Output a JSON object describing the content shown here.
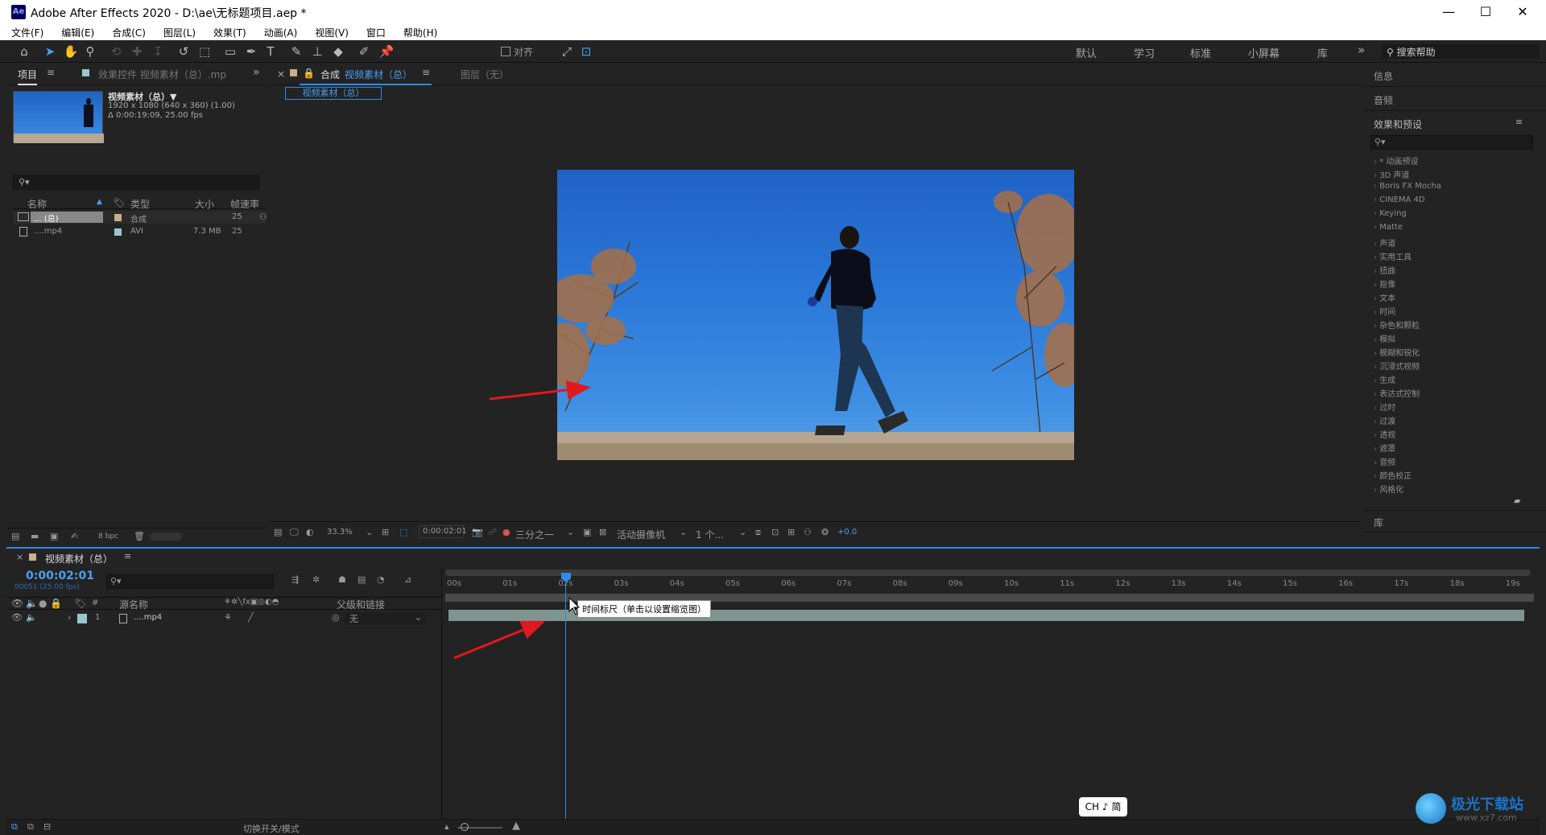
{
  "titlebar": {
    "app_icon": "Ae",
    "title": "Adobe After Effects 2020 - D:\\ae\\无标题项目.aep *",
    "minimize": "—",
    "maximize": "☐",
    "close": "✕"
  },
  "menu": [
    "文件(F)",
    "编辑(E)",
    "合成(C)",
    "图层(L)",
    "效果(T)",
    "动画(A)",
    "视图(V)",
    "窗口",
    "帮助(H)"
  ],
  "toolbar": {
    "align_label": "对齐",
    "workspaces": [
      "默认",
      "学习",
      "标准",
      "小屏幕",
      "库"
    ],
    "more": "»",
    "search_placeholder": "搜索帮助"
  },
  "project_panel": {
    "tab_project": "项目",
    "tab_effects": "效果控件 视频素材（总）.mp",
    "more": "»",
    "asset": {
      "name": "视频素材（总）▼",
      "res": "1920 x 1080  (640 x 360) (1.00)",
      "duration": "Δ 0:00:19:09, 25.00 fps"
    },
    "columns": [
      "名称",
      "类型",
      "大小",
      "帧速率"
    ],
    "rows": [
      {
        "name": "... (总)",
        "type": "合成",
        "size": "",
        "fps": "25",
        "color": "#c8b08a"
      },
      {
        "name": "....mp4",
        "type": "AVI",
        "size": "7.3 MB",
        "fps": "25",
        "color": "#9ac6d0"
      }
    ],
    "bpc": "8 bpc"
  },
  "viewer": {
    "tab_comp_prefix": "合成",
    "tab_comp_name": "视频素材（总）",
    "tab_layer": "图层（无）",
    "crumb": "视频素材（总）",
    "zoom": "33.3%",
    "timecode": "0:00:02:01",
    "resolution": "三分之一",
    "camera": "活动摄像机",
    "views": "1 个...",
    "exposure": "+0.0"
  },
  "right_panel": {
    "info": "信息",
    "audio": "音频",
    "effects_title": "效果和预设",
    "library": "库",
    "effects": [
      "* 动画预设",
      "3D 声道",
      "Boris FX Mocha",
      "CINEMA 4D",
      "Keying",
      "Matte",
      "声道",
      "实用工具",
      "扭曲",
      "抠像",
      "文本",
      "时间",
      "杂色和颗粒",
      "模拟",
      "模糊和锐化",
      "沉浸式视频",
      "生成",
      "表达式控制",
      "过时",
      "过渡",
      "透视",
      "遮罩",
      "音频",
      "颜色校正",
      "风格化"
    ]
  },
  "timeline": {
    "tab": "视频素材（总）",
    "timecode": "0:00:02:01",
    "frames": "00051 (25.00 fps)",
    "col_source": "源名称",
    "col_parent": "父级和链接",
    "layer": {
      "index": "1",
      "name": "....mp4",
      "parent": "无"
    },
    "ruler": [
      "00s",
      "01s",
      "02s",
      "03s",
      "04s",
      "05s",
      "06s",
      "07s",
      "08s",
      "09s",
      "10s",
      "11s",
      "12s",
      "13s",
      "14s",
      "15s",
      "16s",
      "17s",
      "18s",
      "19s"
    ],
    "tooltip": "时间标尺（单击以设置缩览图）",
    "toggle_label": "切换开关/模式",
    "ime": "CH ♪ 简"
  },
  "watermark": {
    "text": "极光下载站",
    "url": "www.xz7.com"
  },
  "colors": {
    "accent": "#2d8ceb",
    "timecode": "#4aa0f0",
    "layer_bar": "#7f9690",
    "arrow": "#e0191e"
  }
}
